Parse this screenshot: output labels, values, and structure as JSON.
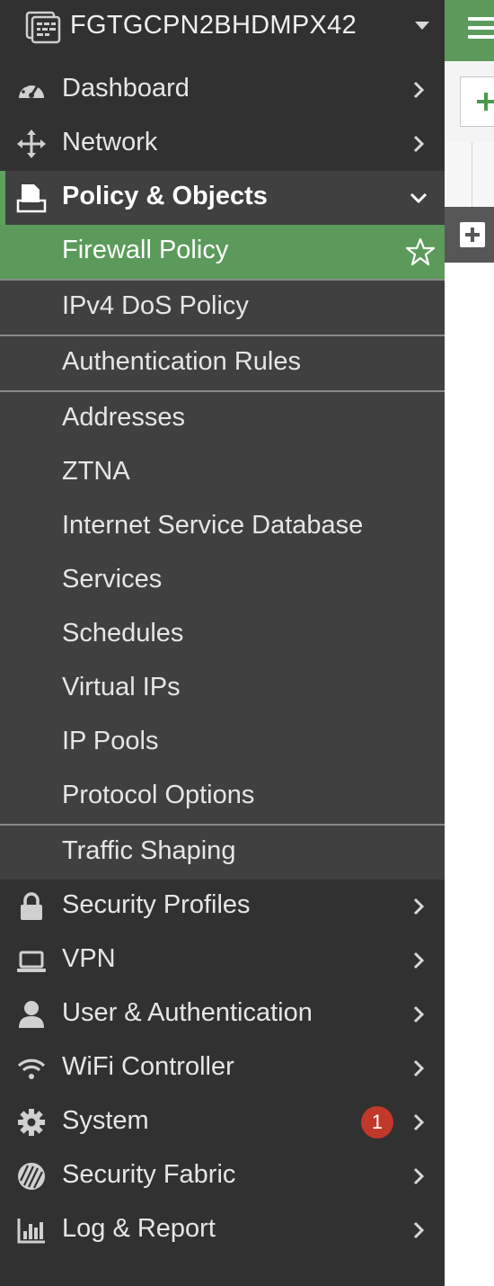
{
  "device": {
    "name": "FGTGCPN2BHDMPX42",
    "icon": "fortigate-device-icon"
  },
  "menu": [
    {
      "label": "Dashboard",
      "icon": "dashboard-icon"
    },
    {
      "label": "Network",
      "icon": "network-icon"
    },
    {
      "label": "Policy & Objects",
      "icon": "policy-icon",
      "expanded": true
    },
    {
      "label": "Security Profiles",
      "icon": "lock-icon"
    },
    {
      "label": "VPN",
      "icon": "laptop-icon"
    },
    {
      "label": "User & Authentication",
      "icon": "user-icon"
    },
    {
      "label": "WiFi Controller",
      "icon": "wifi-icon"
    },
    {
      "label": "System",
      "icon": "gear-icon",
      "badge": "1"
    },
    {
      "label": "Security Fabric",
      "icon": "fabric-icon"
    },
    {
      "label": "Log & Report",
      "icon": "bar-chart-icon"
    }
  ],
  "submenu": [
    {
      "label": "Firewall Policy",
      "selected": true
    },
    {
      "label": "IPv4 DoS Policy"
    },
    {
      "label": "Authentication Rules"
    },
    {
      "label": "Addresses"
    },
    {
      "label": "ZTNA"
    },
    {
      "label": "Internet Service Database"
    },
    {
      "label": "Services"
    },
    {
      "label": "Schedules"
    },
    {
      "label": "Virtual IPs"
    },
    {
      "label": "IP Pools"
    },
    {
      "label": "Protocol Options"
    },
    {
      "label": "Traffic Shaping"
    }
  ],
  "colors": {
    "sidebar_bg": "#313131",
    "submenu_bg": "#404040",
    "accent_green": "#5c9a5c",
    "badge_red": "#c0392b"
  }
}
